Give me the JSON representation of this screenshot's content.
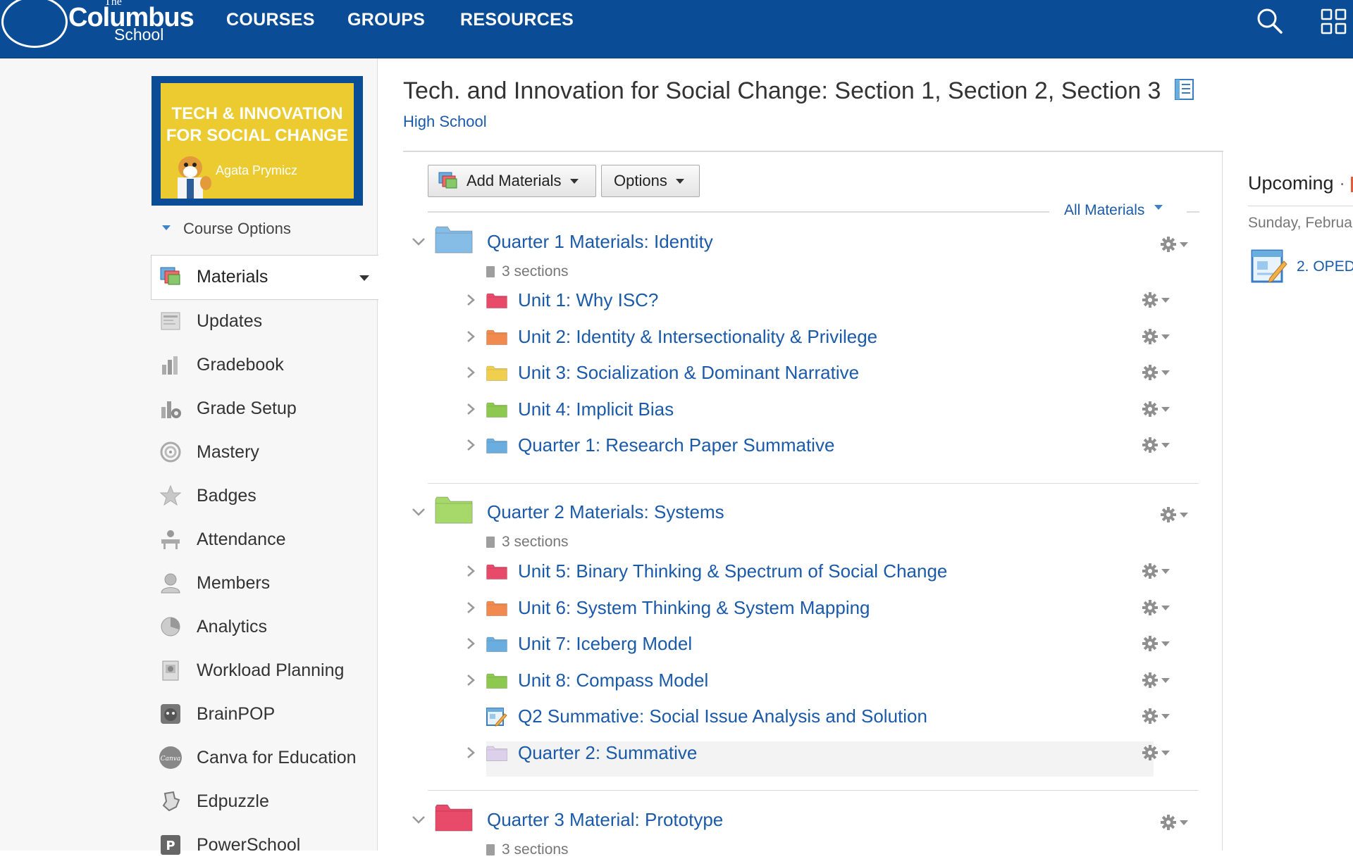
{
  "header": {
    "logo_the": "The",
    "logo_main": "Columbus",
    "logo_school": "School",
    "nav": [
      "COURSES",
      "GROUPS",
      "RESOURCES"
    ],
    "icons": [
      "search-icon",
      "apps-grid-icon"
    ]
  },
  "sidebar": {
    "course_image": {
      "title_line1": "TECH & INNOVATION",
      "title_line2": "FOR SOCIAL CHANGE",
      "teacher": "Agata Prymicz"
    },
    "course_options": "Course Options",
    "items": [
      {
        "label": "Materials",
        "icon": "materials-icon",
        "active": true
      },
      {
        "label": "Updates",
        "icon": "updates-icon"
      },
      {
        "label": "Gradebook",
        "icon": "gradebook-icon"
      },
      {
        "label": "Grade Setup",
        "icon": "grade-setup-icon"
      },
      {
        "label": "Mastery",
        "icon": "mastery-icon"
      },
      {
        "label": "Badges",
        "icon": "badges-icon"
      },
      {
        "label": "Attendance",
        "icon": "attendance-icon"
      },
      {
        "label": "Members",
        "icon": "members-icon"
      },
      {
        "label": "Analytics",
        "icon": "analytics-icon"
      },
      {
        "label": "Workload Planning",
        "icon": "workload-planning-icon"
      },
      {
        "label": "BrainPOP",
        "icon": "brainpop-icon"
      },
      {
        "label": "Canva for Education",
        "icon": "canva-icon",
        "icon_text": "Canva"
      },
      {
        "label": "Edpuzzle",
        "icon": "edpuzzle-icon"
      },
      {
        "label": "PowerSchool",
        "icon": "powerschool-icon",
        "icon_text": "P"
      }
    ]
  },
  "main": {
    "title": "Tech. and Innovation for Social Change: Section 1, Section 2, Section 3",
    "subtitle": "High School",
    "toolbar": {
      "add_materials": "Add Materials",
      "options": "Options",
      "filter": "All Materials"
    },
    "quarters": [
      {
        "title": "Quarter 1 Materials: Identity",
        "folder_color": "#86bde6",
        "sections": "3 sections",
        "units": [
          {
            "title": "Unit 1: Why ISC?",
            "color": "#e84a6a",
            "type": "folder"
          },
          {
            "title": "Unit 2: Identity & Intersectionality & Privilege",
            "color": "#f08a4e",
            "type": "folder"
          },
          {
            "title": "Unit 3: Socialization & Dominant Narrative",
            "color": "#f0cf4e",
            "type": "folder"
          },
          {
            "title": "Unit 4: Implicit Bias",
            "color": "#8dc94e",
            "type": "folder"
          },
          {
            "title": "Quarter 1: Research Paper Summative",
            "color": "#6aaee0",
            "type": "folder"
          }
        ]
      },
      {
        "title": "Quarter 2 Materials: Systems",
        "folder_color": "#a6d96a",
        "sections": "3 sections",
        "units": [
          {
            "title": "Unit 5: Binary Thinking & Spectrum of Social Change",
            "color": "#e84a6a",
            "type": "folder"
          },
          {
            "title": "Unit 6: System Thinking & System Mapping",
            "color": "#f08a4e",
            "type": "folder"
          },
          {
            "title": "Unit 7: Iceberg Model",
            "color": "#6aaee0",
            "type": "folder"
          },
          {
            "title": "Unit 8: Compass Model",
            "color": "#8dc94e",
            "type": "folder"
          },
          {
            "title": "Q2 Summative: Social Issue Analysis and Solution",
            "color": "#6aaee0",
            "type": "assignment"
          },
          {
            "title": "Quarter 2: Summative",
            "color": "#dcd0ea",
            "type": "folder"
          }
        ]
      },
      {
        "title": "Quarter 3 Material: Prototype",
        "folder_color": "#e84a6a",
        "sections": "3 sections",
        "units": []
      }
    ]
  },
  "upcoming": {
    "title": "Upcoming",
    "date": "Sunday, Februa",
    "item": "2. OPED"
  }
}
